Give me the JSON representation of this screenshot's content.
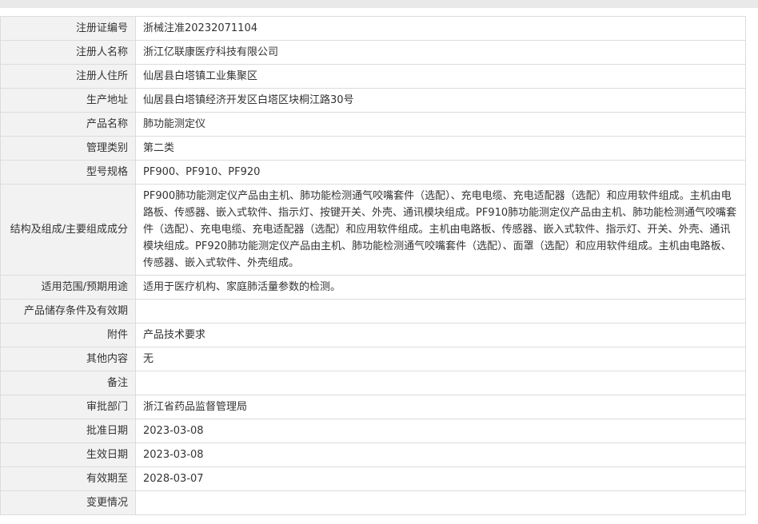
{
  "rows": [
    {
      "label": "注册证编号",
      "value": "浙械注准20232071104"
    },
    {
      "label": "注册人名称",
      "value": "浙江亿联康医疗科技有限公司"
    },
    {
      "label": "注册人住所",
      "value": "仙居县白塔镇工业集聚区"
    },
    {
      "label": "生产地址",
      "value": "仙居县白塔镇经济开发区白塔区块桐江路30号"
    },
    {
      "label": "产品名称",
      "value": "肺功能测定仪"
    },
    {
      "label": "管理类别",
      "value": "第二类"
    },
    {
      "label": "型号规格",
      "value": "PF900、PF910、PF920"
    },
    {
      "label": "结构及组成/主要组成成分",
      "value": "PF900肺功能测定仪产品由主机、肺功能检测通气咬嘴套件（选配）、充电电缆、充电适配器（选配）和应用软件组成。主机由电路板、传感器、嵌入式软件、指示灯、按键开关、外壳、通讯模块组成。PF910肺功能测定仪产品由主机、肺功能检测通气咬嘴套件（选配）、充电电缆、充电适配器（选配）和应用软件组成。主机由电路板、传感器、嵌入式软件、指示灯、开关、外壳、通讯模块组成。PF920肺功能测定仪产品由主机、肺功能检测通气咬嘴套件（选配）、面罩（选配）和应用软件组成。主机由电路板、传感器、嵌入式软件、外壳组成。"
    },
    {
      "label": "适用范围/预期用途",
      "value": "适用于医疗机构、家庭肺活量参数的检测。"
    },
    {
      "label": "产品储存条件及有效期",
      "value": ""
    },
    {
      "label": "附件",
      "value": "产品技术要求"
    },
    {
      "label": "其他内容",
      "value": "无"
    },
    {
      "label": "备注",
      "value": ""
    },
    {
      "label": "审批部门",
      "value": "浙江省药品监督管理局"
    },
    {
      "label": "批准日期",
      "value": "2023-03-08"
    },
    {
      "label": "生效日期",
      "value": "2023-03-08"
    },
    {
      "label": "有效期至",
      "value": "2028-03-07"
    },
    {
      "label": "变更情况",
      "value": ""
    }
  ]
}
